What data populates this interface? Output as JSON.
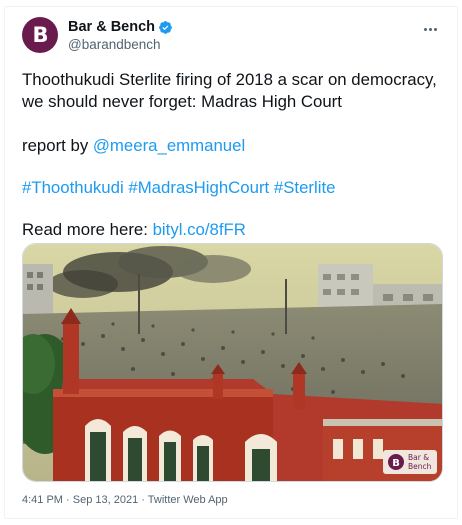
{
  "tweet": {
    "author": {
      "display_name": "Bar & Bench",
      "handle": "@barandbench",
      "avatar_letter": "B",
      "avatar_color": "#6a1b4d",
      "verified": true
    },
    "more_icon": "more-horizontal-icon",
    "headline": "Thoothukudi Sterlite firing of 2018 a scar on democracy, we should never forget: Madras High Court",
    "report_prefix": "report by ",
    "report_mention": "@meera_emmanuel",
    "hashtags": [
      "#Thoothukudi",
      "#MadrasHighCourt",
      "#Sterlite"
    ],
    "read_more_prefix": "Read more here: ",
    "read_more_link": "bityl.co/8fFR",
    "media": {
      "watermark_line1": "Bar &",
      "watermark_line2": "Bench"
    },
    "timestamp": "4:41 PM · Sep 13, 2021 · Twitter Web App"
  },
  "colors": {
    "link": "#1d9bf0",
    "text": "#0f1419",
    "secondary": "#536471",
    "brand": "#6a1b4d"
  }
}
